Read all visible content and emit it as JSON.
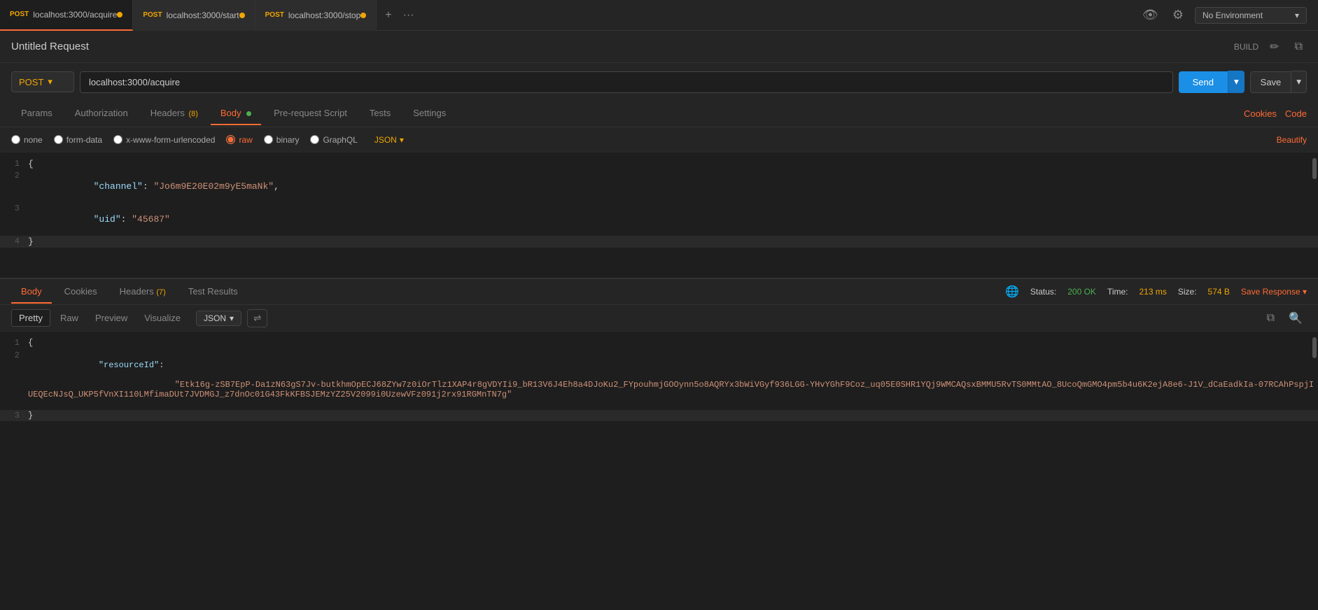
{
  "tabs": [
    {
      "method": "POST",
      "url": "localhost:3000/acquire",
      "active": true
    },
    {
      "method": "POST",
      "url": "localhost:3000/start",
      "active": false
    },
    {
      "method": "POST",
      "url": "localhost:3000/stop",
      "active": false
    }
  ],
  "env": {
    "label": "No Environment",
    "placeholder": "No Environment"
  },
  "request": {
    "title": "Untitled Request",
    "build_label": "BUILD",
    "method": "POST",
    "url": "localhost:3000/acquire",
    "send_label": "Send",
    "save_label": "Save"
  },
  "req_tabs": {
    "items": [
      {
        "label": "Params",
        "active": false,
        "badge": null
      },
      {
        "label": "Authorization",
        "active": false,
        "badge": null
      },
      {
        "label": "Headers",
        "active": false,
        "badge": "(8)"
      },
      {
        "label": "Body",
        "active": true,
        "badge": null,
        "dot": true
      },
      {
        "label": "Pre-request Script",
        "active": false,
        "badge": null
      },
      {
        "label": "Tests",
        "active": false,
        "badge": null
      },
      {
        "label": "Settings",
        "active": false,
        "badge": null
      }
    ],
    "right_links": [
      "Cookies",
      "Code"
    ]
  },
  "body_types": [
    {
      "label": "none",
      "value": "none"
    },
    {
      "label": "form-data",
      "value": "form-data"
    },
    {
      "label": "x-www-form-urlencoded",
      "value": "x-www-form-urlencoded"
    },
    {
      "label": "raw",
      "value": "raw",
      "active": true
    },
    {
      "label": "binary",
      "value": "binary"
    },
    {
      "label": "GraphQL",
      "value": "graphql"
    }
  ],
  "json_format": "JSON",
  "beautify_label": "Beautify",
  "request_body": {
    "lines": [
      {
        "num": 1,
        "content": "{",
        "type": "brace"
      },
      {
        "num": 2,
        "content": "    \"channel\": \"Jo6m9E20E02m9yE5maNk\",",
        "type": "key-value-str",
        "key": "channel",
        "value": "Jo6m9E20E02m9yE5maNk"
      },
      {
        "num": 3,
        "content": "    \"uid\": \"45687\"",
        "type": "key-value-str",
        "key": "uid",
        "value": "45687"
      },
      {
        "num": 4,
        "content": "}",
        "type": "brace",
        "highlighted": true
      }
    ]
  },
  "response": {
    "tabs": [
      {
        "label": "Body",
        "active": true
      },
      {
        "label": "Cookies",
        "active": false
      },
      {
        "label": "Headers",
        "active": false,
        "badge": "(7)"
      },
      {
        "label": "Test Results",
        "active": false
      }
    ],
    "status_label": "Status:",
    "status_value": "200 OK",
    "time_label": "Time:",
    "time_value": "213 ms",
    "size_label": "Size:",
    "size_value": "574 B",
    "save_response_label": "Save Response",
    "format_tabs": [
      "Pretty",
      "Raw",
      "Preview",
      "Visualize"
    ],
    "active_format": "Pretty",
    "format_options": [
      "JSON"
    ],
    "selected_format": "JSON",
    "body_lines": [
      {
        "num": 1,
        "content": "{"
      },
      {
        "num": 2,
        "content": "    \"resourceId\":\n        \"Etk16g-zSB7EpP-Da1zN63gS7Jv-butkhmOpECJ68ZYw7z0iOrTlz1XAP4r8gVDYIi9_bR13V6J4Eh8a4DJoKu2_FYpouhmjGOOynn5o8AQRYx3bWiVGyf936LGG-YHvYGhF9Coz_uq05E0SHR1YQj9WMCAQsxBMMU5RvTS0MMtAO_8UcoQmGMO4pm5b4u6K2ejA8e6-J1V_dCaEadkIa-07RCAhPspjIUEQEcNJsQ_UKP5fVnXI110LMfimaDUt7JVDMGJ_z7dnOc01G43FkKFBSJEMzYZ25V2099i0UzewVFz091j2rx91RGMnTN7g\""
      },
      {
        "num": 3,
        "content": "}"
      }
    ]
  }
}
